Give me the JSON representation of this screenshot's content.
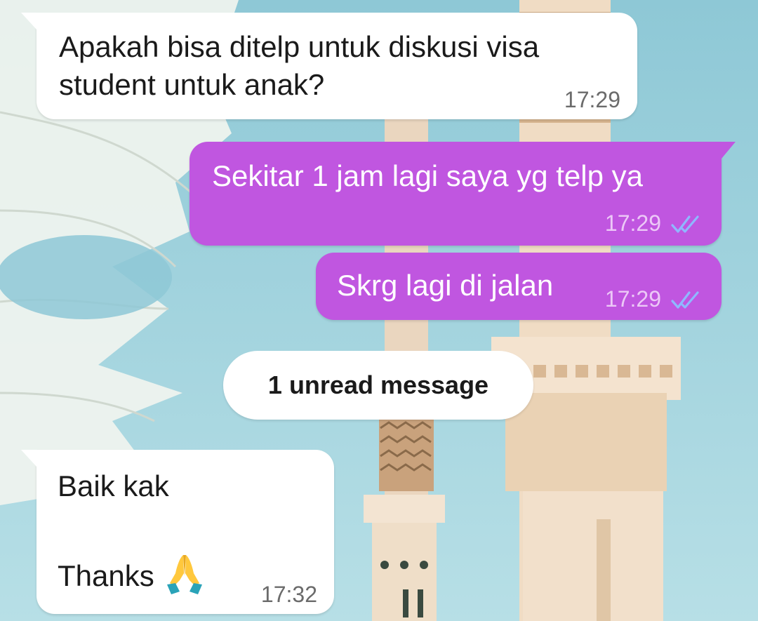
{
  "messages": [
    {
      "direction": "incoming",
      "text": "Apakah bisa ditelp untuk diskusi visa\nstudent untuk anak?",
      "time": "17:29"
    },
    {
      "direction": "outgoing",
      "text": "Sekitar 1 jam lagi saya yg telp ya",
      "time": "17:29",
      "status": "read-double-check-icon"
    },
    {
      "direction": "outgoing",
      "text": "Skrg lagi di jalan",
      "time": "17:29",
      "status": "read-double-check-icon"
    },
    {
      "direction": "incoming",
      "text_line1": "Baik kak",
      "text_line2": "Thanks",
      "emoji": "folded-hands-icon",
      "time": "17:32"
    }
  ],
  "unread_divider": {
    "label": "1 unread message"
  },
  "colors": {
    "outgoing_bubble": "#c056e0",
    "incoming_bubble": "#ffffff",
    "read_ticks": "#8fb8ff",
    "wallpaper_sky": "#9fd0dc"
  },
  "wallpaper": {
    "subject": "mosque-minaret-wallpaper"
  }
}
